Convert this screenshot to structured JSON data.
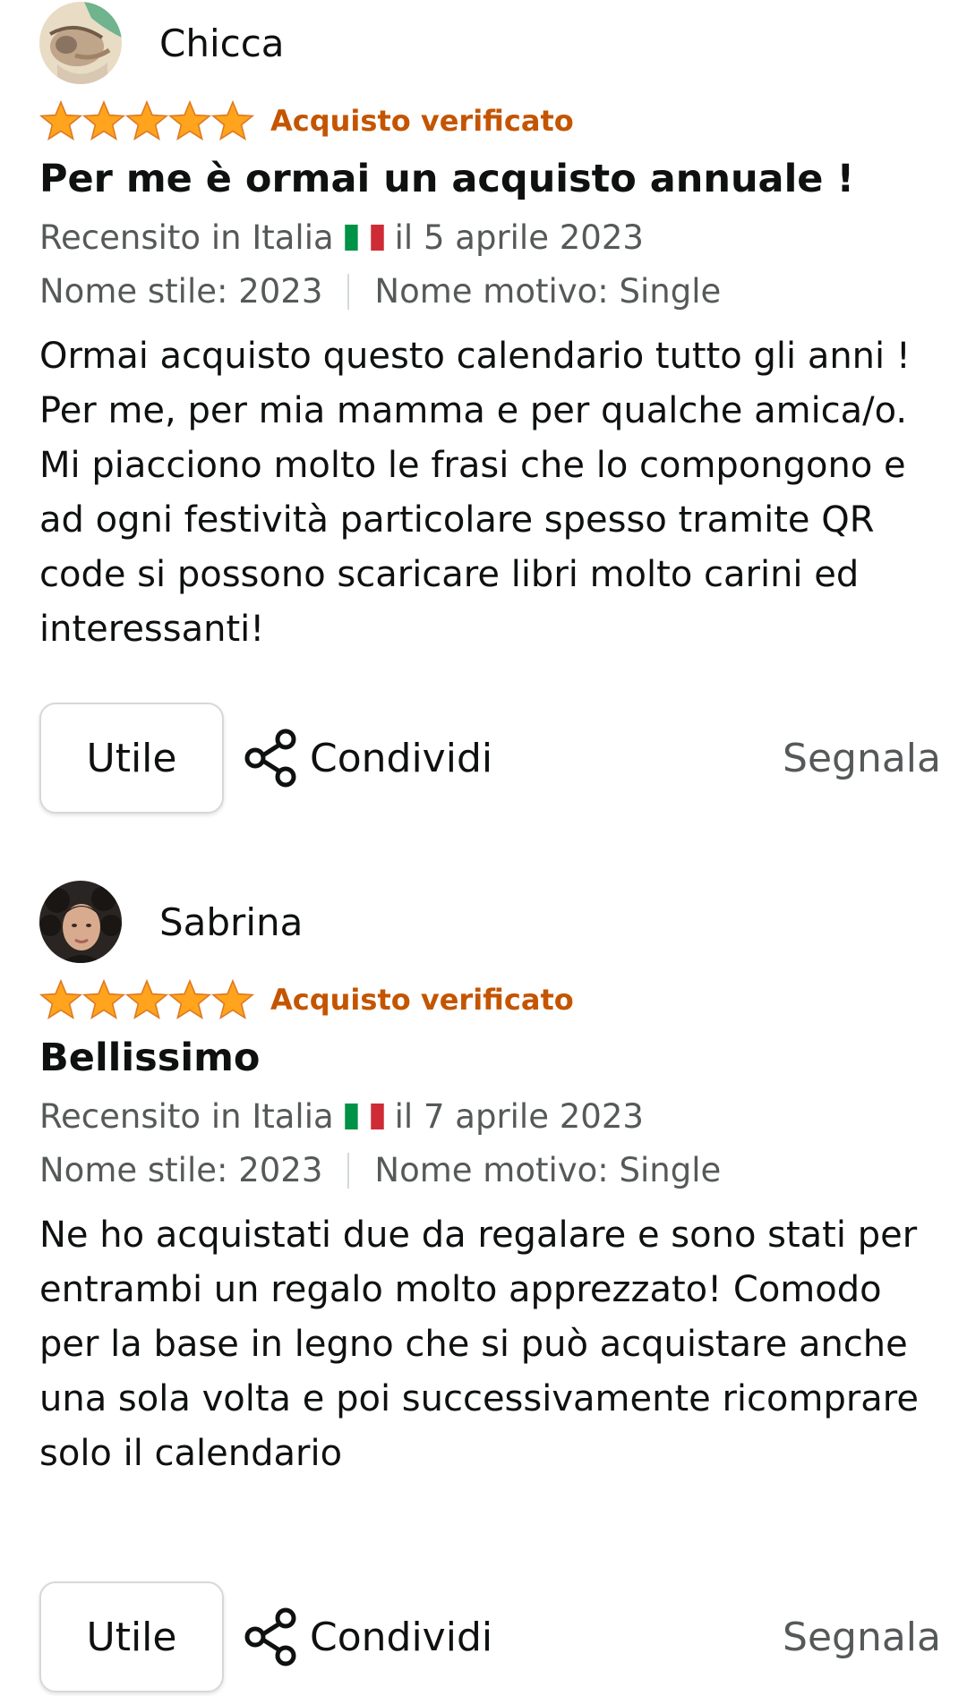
{
  "colors": {
    "star": "#ffa41c",
    "verified": "#c45500",
    "secondary_text": "#565959"
  },
  "reviews": [
    {
      "author": "Chicca",
      "rating_stars": 5,
      "verified_label": "Acquisto verificato",
      "title": "Per me è ormai un acquisto annuale !",
      "reviewed_prefix": "Recensito in Italia",
      "reviewed_date": "il 5 aprile 2023",
      "style_label": "Nome stile: 2023",
      "pattern_label": "Nome motivo: Single",
      "body": "Ormai acquisto questo calendario tutto gli anni ! Per me, per mia mamma e per qualche amica/o. Mi piacciono molto le frasi che lo compongono e ad ogni festività particolare spesso tramite QR code si possono scaricare libri molto carini ed interessanti!",
      "helpful_label": "Utile",
      "share_label": "Condividi",
      "report_label": "Segnala"
    },
    {
      "author": "Sabrina",
      "rating_stars": 5,
      "verified_label": "Acquisto verificato",
      "title": "Bellissimo",
      "reviewed_prefix": "Recensito in Italia",
      "reviewed_date": "il 7 aprile 2023",
      "style_label": "Nome stile: 2023",
      "pattern_label": "Nome motivo: Single",
      "body": "Ne ho acquistati due da regalare e sono stati per entrambi un regalo molto apprezzato! Comodo per la base in legno che si può acquistare anche una sola volta e poi successivamente ricomprare solo il calendario",
      "helpful_label": "Utile",
      "share_label": "Condividi",
      "report_label": "Segnala"
    }
  ]
}
